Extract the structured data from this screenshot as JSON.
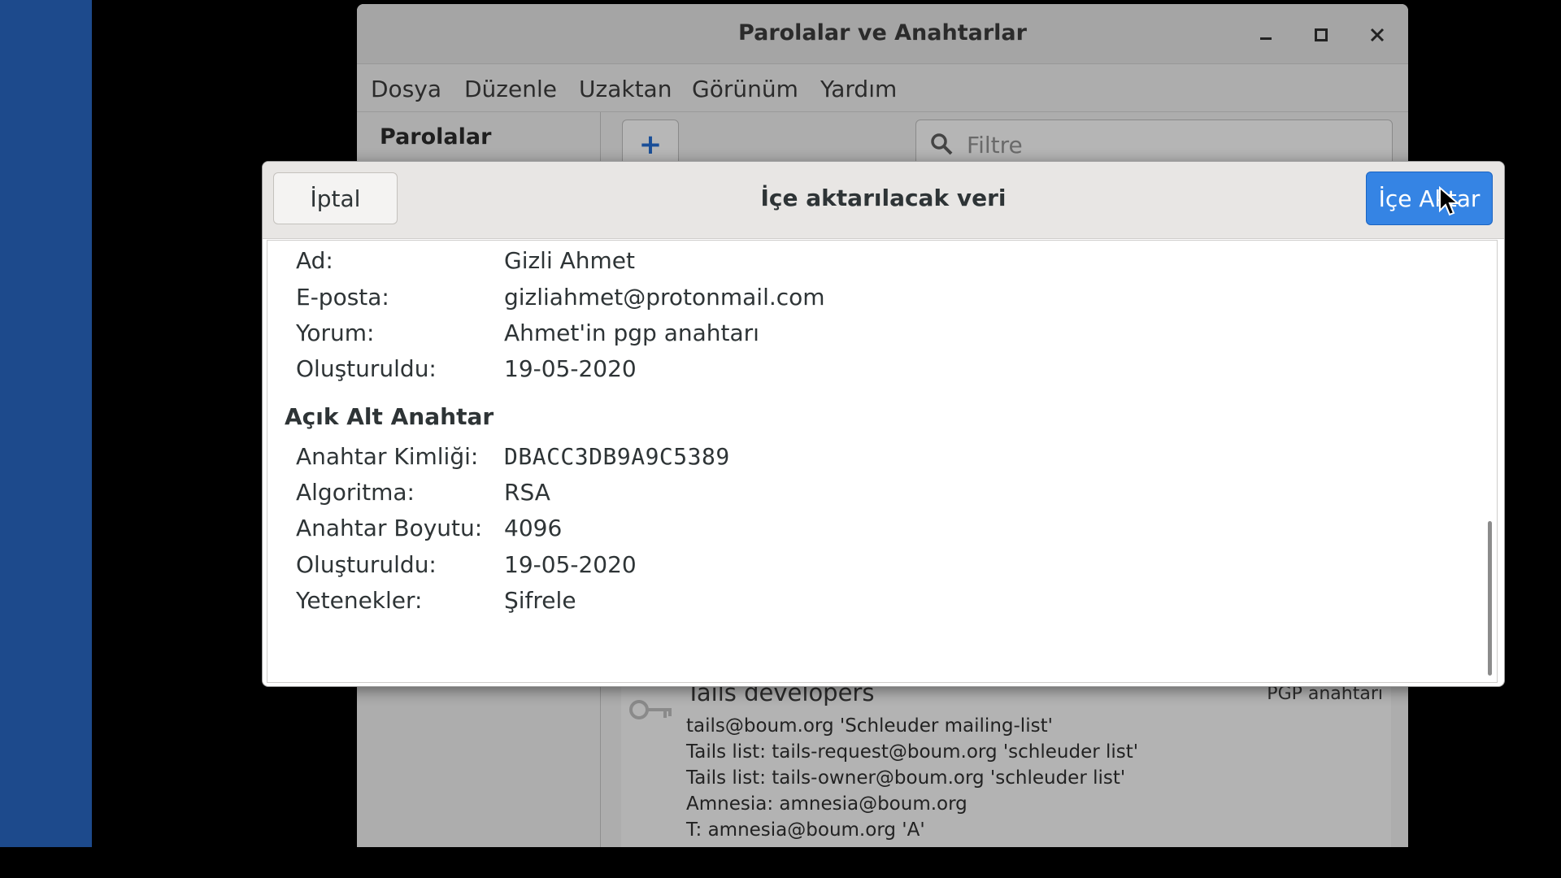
{
  "window": {
    "title": "Parolalar ve Anahtarlar",
    "controls": {
      "minimize": "–",
      "maximize": "□",
      "close": "✕"
    }
  },
  "menubar": {
    "items": [
      "Dosya",
      "Düzenle",
      "Uzaktan",
      "Görünüm",
      "Yardım"
    ]
  },
  "sidebar": {
    "heading": "Parolalar"
  },
  "toolbar": {
    "add_label": "+",
    "filter_placeholder": "Filtre"
  },
  "keylist": {
    "item": {
      "name": "Tails developers",
      "type": "PGP anahtarı",
      "lines": [
        "tails@boum.org 'Schleuder mailing-list'",
        "Tails list: tails-request@boum.org 'schleuder list'",
        "Tails list: tails-owner@boum.org 'schleuder list'",
        "Amnesia: amnesia@boum.org",
        "T: amnesia@boum.org 'A'"
      ]
    }
  },
  "dialog": {
    "title": "İçe aktarılacak veri",
    "cancel_label": "İptal",
    "import_label": "İçe Aktar",
    "fields": [
      {
        "label": "Ad:",
        "value": "Gizli Ahmet"
      },
      {
        "label": "E-posta:",
        "value": "gizliahmet@protonmail.com"
      },
      {
        "label": "Yorum:",
        "value": "Ahmet'in pgp anahtarı"
      },
      {
        "label": "Oluşturuldu:",
        "value": "19-05-2020"
      }
    ],
    "subkey_section": "Açık Alt Anahtar",
    "subkey_fields": [
      {
        "label": "Anahtar Kimliği:",
        "value": "DBACC3DB9A9C5389"
      },
      {
        "label": "Algoritma:",
        "value": "RSA"
      },
      {
        "label": "Anahtar Boyutu:",
        "value": "4096"
      },
      {
        "label": "Oluşturuldu:",
        "value": "19-05-2020"
      },
      {
        "label": "Yetenekler:",
        "value": "Şifrele"
      }
    ]
  },
  "colors": {
    "accent": "#3584e4",
    "desktop": "#1d4a8c"
  }
}
